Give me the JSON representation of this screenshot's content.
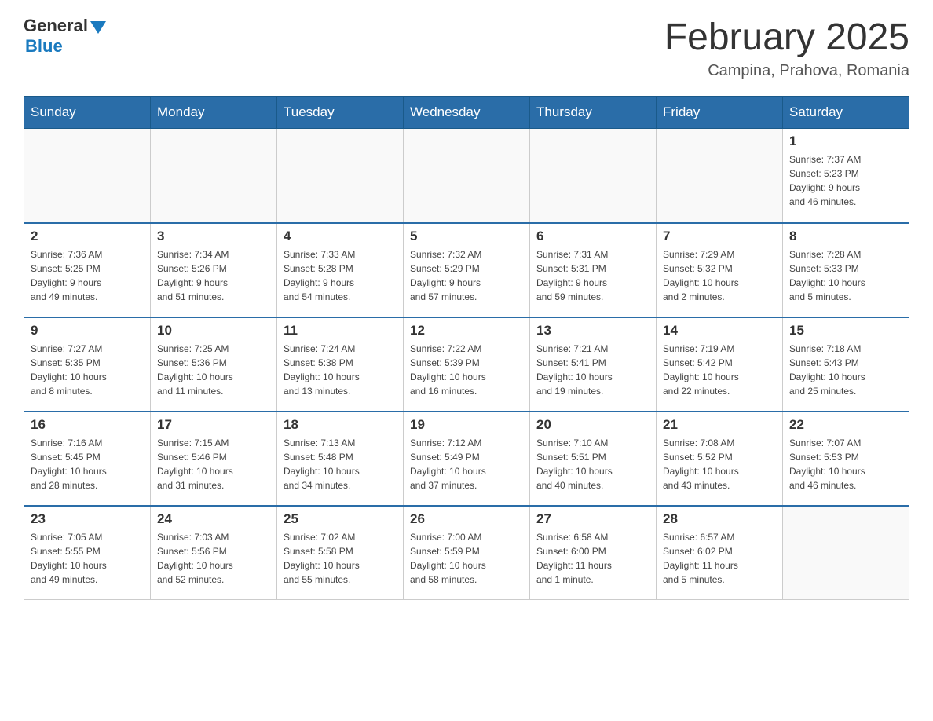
{
  "header": {
    "logo_general": "General",
    "logo_blue": "Blue",
    "month_title": "February 2025",
    "location": "Campina, Prahova, Romania"
  },
  "days_of_week": [
    "Sunday",
    "Monday",
    "Tuesday",
    "Wednesday",
    "Thursday",
    "Friday",
    "Saturday"
  ],
  "weeks": [
    {
      "days": [
        {
          "number": "",
          "info": ""
        },
        {
          "number": "",
          "info": ""
        },
        {
          "number": "",
          "info": ""
        },
        {
          "number": "",
          "info": ""
        },
        {
          "number": "",
          "info": ""
        },
        {
          "number": "",
          "info": ""
        },
        {
          "number": "1",
          "info": "Sunrise: 7:37 AM\nSunset: 5:23 PM\nDaylight: 9 hours\nand 46 minutes."
        }
      ]
    },
    {
      "days": [
        {
          "number": "2",
          "info": "Sunrise: 7:36 AM\nSunset: 5:25 PM\nDaylight: 9 hours\nand 49 minutes."
        },
        {
          "number": "3",
          "info": "Sunrise: 7:34 AM\nSunset: 5:26 PM\nDaylight: 9 hours\nand 51 minutes."
        },
        {
          "number": "4",
          "info": "Sunrise: 7:33 AM\nSunset: 5:28 PM\nDaylight: 9 hours\nand 54 minutes."
        },
        {
          "number": "5",
          "info": "Sunrise: 7:32 AM\nSunset: 5:29 PM\nDaylight: 9 hours\nand 57 minutes."
        },
        {
          "number": "6",
          "info": "Sunrise: 7:31 AM\nSunset: 5:31 PM\nDaylight: 9 hours\nand 59 minutes."
        },
        {
          "number": "7",
          "info": "Sunrise: 7:29 AM\nSunset: 5:32 PM\nDaylight: 10 hours\nand 2 minutes."
        },
        {
          "number": "8",
          "info": "Sunrise: 7:28 AM\nSunset: 5:33 PM\nDaylight: 10 hours\nand 5 minutes."
        }
      ]
    },
    {
      "days": [
        {
          "number": "9",
          "info": "Sunrise: 7:27 AM\nSunset: 5:35 PM\nDaylight: 10 hours\nand 8 minutes."
        },
        {
          "number": "10",
          "info": "Sunrise: 7:25 AM\nSunset: 5:36 PM\nDaylight: 10 hours\nand 11 minutes."
        },
        {
          "number": "11",
          "info": "Sunrise: 7:24 AM\nSunset: 5:38 PM\nDaylight: 10 hours\nand 13 minutes."
        },
        {
          "number": "12",
          "info": "Sunrise: 7:22 AM\nSunset: 5:39 PM\nDaylight: 10 hours\nand 16 minutes."
        },
        {
          "number": "13",
          "info": "Sunrise: 7:21 AM\nSunset: 5:41 PM\nDaylight: 10 hours\nand 19 minutes."
        },
        {
          "number": "14",
          "info": "Sunrise: 7:19 AM\nSunset: 5:42 PM\nDaylight: 10 hours\nand 22 minutes."
        },
        {
          "number": "15",
          "info": "Sunrise: 7:18 AM\nSunset: 5:43 PM\nDaylight: 10 hours\nand 25 minutes."
        }
      ]
    },
    {
      "days": [
        {
          "number": "16",
          "info": "Sunrise: 7:16 AM\nSunset: 5:45 PM\nDaylight: 10 hours\nand 28 minutes."
        },
        {
          "number": "17",
          "info": "Sunrise: 7:15 AM\nSunset: 5:46 PM\nDaylight: 10 hours\nand 31 minutes."
        },
        {
          "number": "18",
          "info": "Sunrise: 7:13 AM\nSunset: 5:48 PM\nDaylight: 10 hours\nand 34 minutes."
        },
        {
          "number": "19",
          "info": "Sunrise: 7:12 AM\nSunset: 5:49 PM\nDaylight: 10 hours\nand 37 minutes."
        },
        {
          "number": "20",
          "info": "Sunrise: 7:10 AM\nSunset: 5:51 PM\nDaylight: 10 hours\nand 40 minutes."
        },
        {
          "number": "21",
          "info": "Sunrise: 7:08 AM\nSunset: 5:52 PM\nDaylight: 10 hours\nand 43 minutes."
        },
        {
          "number": "22",
          "info": "Sunrise: 7:07 AM\nSunset: 5:53 PM\nDaylight: 10 hours\nand 46 minutes."
        }
      ]
    },
    {
      "days": [
        {
          "number": "23",
          "info": "Sunrise: 7:05 AM\nSunset: 5:55 PM\nDaylight: 10 hours\nand 49 minutes."
        },
        {
          "number": "24",
          "info": "Sunrise: 7:03 AM\nSunset: 5:56 PM\nDaylight: 10 hours\nand 52 minutes."
        },
        {
          "number": "25",
          "info": "Sunrise: 7:02 AM\nSunset: 5:58 PM\nDaylight: 10 hours\nand 55 minutes."
        },
        {
          "number": "26",
          "info": "Sunrise: 7:00 AM\nSunset: 5:59 PM\nDaylight: 10 hours\nand 58 minutes."
        },
        {
          "number": "27",
          "info": "Sunrise: 6:58 AM\nSunset: 6:00 PM\nDaylight: 11 hours\nand 1 minute."
        },
        {
          "number": "28",
          "info": "Sunrise: 6:57 AM\nSunset: 6:02 PM\nDaylight: 11 hours\nand 5 minutes."
        },
        {
          "number": "",
          "info": ""
        }
      ]
    }
  ]
}
